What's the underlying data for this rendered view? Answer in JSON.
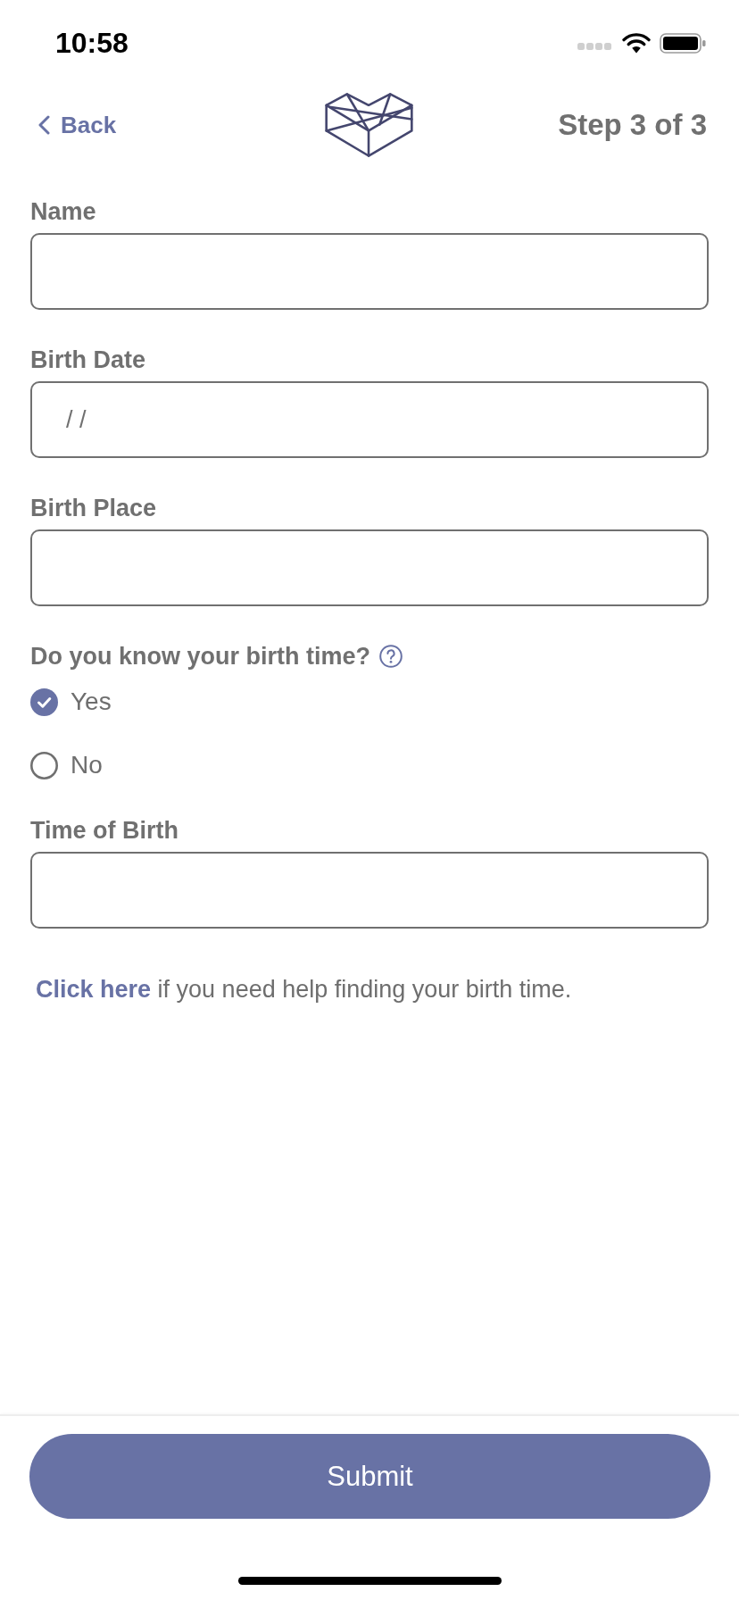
{
  "status_bar": {
    "time": "10:58"
  },
  "header": {
    "back_label": "Back",
    "step": "Step 3 of 3"
  },
  "fields": [
    {
      "kind": "text",
      "label": "Name"
    },
    {
      "kind": "date",
      "label": "Birth Date",
      "placeholder": "/ /"
    },
    {
      "kind": "text",
      "label": "Birth Place"
    }
  ],
  "birth_time_question": {
    "label": "Do you know your birth time?",
    "options": [
      {
        "label": "Yes",
        "selected": true
      },
      {
        "label": "No",
        "selected": false
      }
    ]
  },
  "time_of_birth": {
    "kind": "text",
    "label": "Time of Birth"
  },
  "help": {
    "link": "Click here",
    "text": "if you need help finding your birth time."
  },
  "submit": {
    "label": "Submit"
  }
}
